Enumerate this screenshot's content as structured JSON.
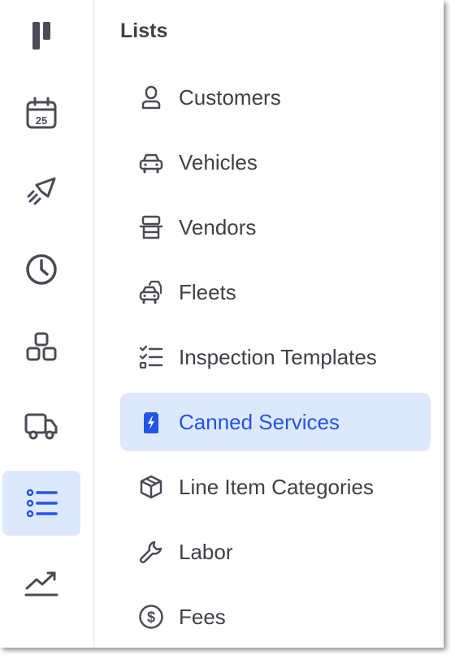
{
  "sidebar": {
    "items": [
      {
        "icon": "brand-logo-icon",
        "active": false
      },
      {
        "icon": "calendar-icon",
        "day": "25",
        "active": false
      },
      {
        "icon": "rocket-icon",
        "active": false
      },
      {
        "icon": "clock-icon",
        "active": false
      },
      {
        "icon": "boxes-icon",
        "active": false
      },
      {
        "icon": "truck-icon",
        "active": false
      },
      {
        "icon": "list-icon",
        "active": true
      },
      {
        "icon": "trending-up-icon",
        "active": false
      }
    ]
  },
  "panel": {
    "title": "Lists",
    "items": [
      {
        "label": "Customers",
        "icon": "user-icon",
        "active": false
      },
      {
        "label": "Vehicles",
        "icon": "car-icon",
        "active": false
      },
      {
        "label": "Vendors",
        "icon": "store-icon",
        "active": false
      },
      {
        "label": "Fleets",
        "icon": "cars-icon",
        "active": false
      },
      {
        "label": "Inspection Templates",
        "icon": "checklist-icon",
        "active": false
      },
      {
        "label": "Canned Services",
        "icon": "canned-service-icon",
        "active": true
      },
      {
        "label": "Line Item Categories",
        "icon": "box-icon",
        "active": false
      },
      {
        "label": "Labor",
        "icon": "wrench-icon",
        "active": false
      },
      {
        "label": "Fees",
        "icon": "dollar-circle-icon",
        "active": false
      }
    ]
  },
  "colors": {
    "accent": "#2354e6",
    "active_bg": "#dde8fd",
    "icon_gray": "#4b4b57",
    "text": "#3f3f46"
  }
}
